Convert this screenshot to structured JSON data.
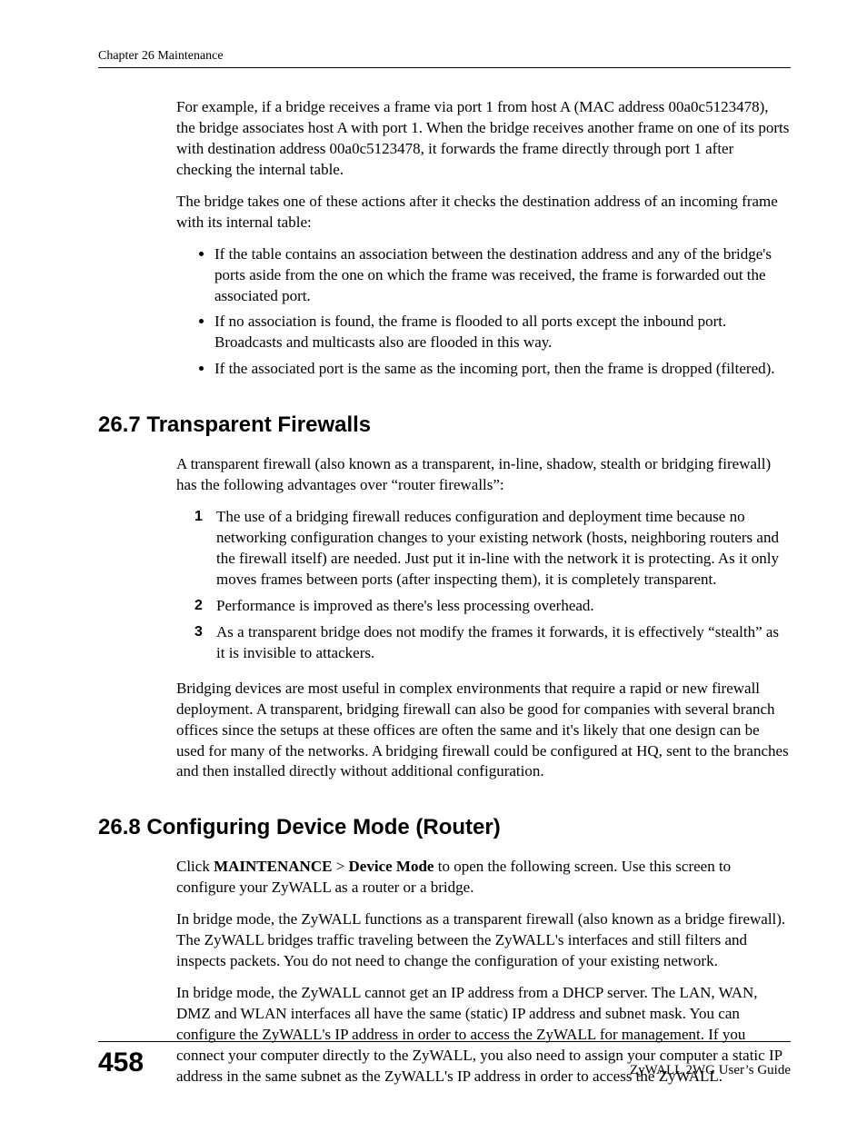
{
  "header": {
    "running_head": "Chapter 26 Maintenance"
  },
  "intro": {
    "p1": "For example, if a bridge receives a frame via port 1 from host A (MAC address 00a0c5123478), the bridge associates host A with port 1. When the bridge receives another frame on one of its ports with destination address 00a0c5123478, it forwards the frame directly through port 1 after checking the internal table.",
    "p2": "The bridge takes one of these actions after it checks the destination address of an incoming frame with its internal table:",
    "bullets": [
      "If the table contains an association between the destination address and any of the bridge's ports aside from the one on which the frame was received, the frame is forwarded out the associated port.",
      "If no association is found, the frame is flooded to all ports except the inbound port. Broadcasts and multicasts also are flooded in this way.",
      "If the associated port is the same as the incoming port, then the frame is dropped (filtered)."
    ]
  },
  "s267": {
    "heading": "26.7  Transparent Firewalls",
    "p1": "A transparent firewall (also known as a transparent, in-line, shadow, stealth or bridging firewall) has the following advantages over “router firewalls”:",
    "items": [
      "The use of a bridging firewall reduces configuration and deployment time because no networking configuration changes to your existing network (hosts, neighboring routers and the firewall itself) are needed. Just put it in-line with the network it is protecting. As it only moves frames between ports (after inspecting them), it is completely transparent.",
      "Performance is improved as there's less processing overhead.",
      "As a transparent bridge does not modify the frames it forwards, it is effectively “stealth” as it is invisible to attackers."
    ],
    "p2": "Bridging devices are most useful in complex environments that require a rapid or new firewall deployment. A transparent, bridging firewall can also be good for companies with several branch offices since the setups at these offices are often the same and it's likely that one design can be used for many of the networks. A bridging firewall could be configured at HQ, sent to the branches and then installed directly without additional configuration."
  },
  "s268": {
    "heading": "26.8  Configuring Device Mode (Router)",
    "p1_pre": "Click ",
    "p1_b1": "MAINTENANCE",
    "p1_mid": " > ",
    "p1_b2": "Device Mode",
    "p1_post": " to open the following screen. Use this screen to configure your ZyWALL as a router or a bridge.",
    "p2": "In bridge mode, the ZyWALL functions as a transparent firewall (also known as a bridge firewall). The ZyWALL bridges traffic traveling between the ZyWALL's interfaces and still filters and inspects packets. You do not need to change the configuration of your existing network.",
    "p3": "In bridge mode, the ZyWALL cannot get an IP address from a DHCP server. The LAN, WAN, DMZ and WLAN interfaces all have the same (static) IP address and subnet mask. You can configure the ZyWALL's IP address in order to access the ZyWALL for management. If you connect your computer directly to the ZyWALL, you also need to assign your computer a static IP address in the same subnet as the ZyWALL's IP address in order to access the ZyWALL."
  },
  "footer": {
    "page_number": "458",
    "doc_title": "ZyWALL 2WG User’s Guide"
  },
  "list_markers": {
    "n1": "1",
    "n2": "2",
    "n3": "3"
  }
}
